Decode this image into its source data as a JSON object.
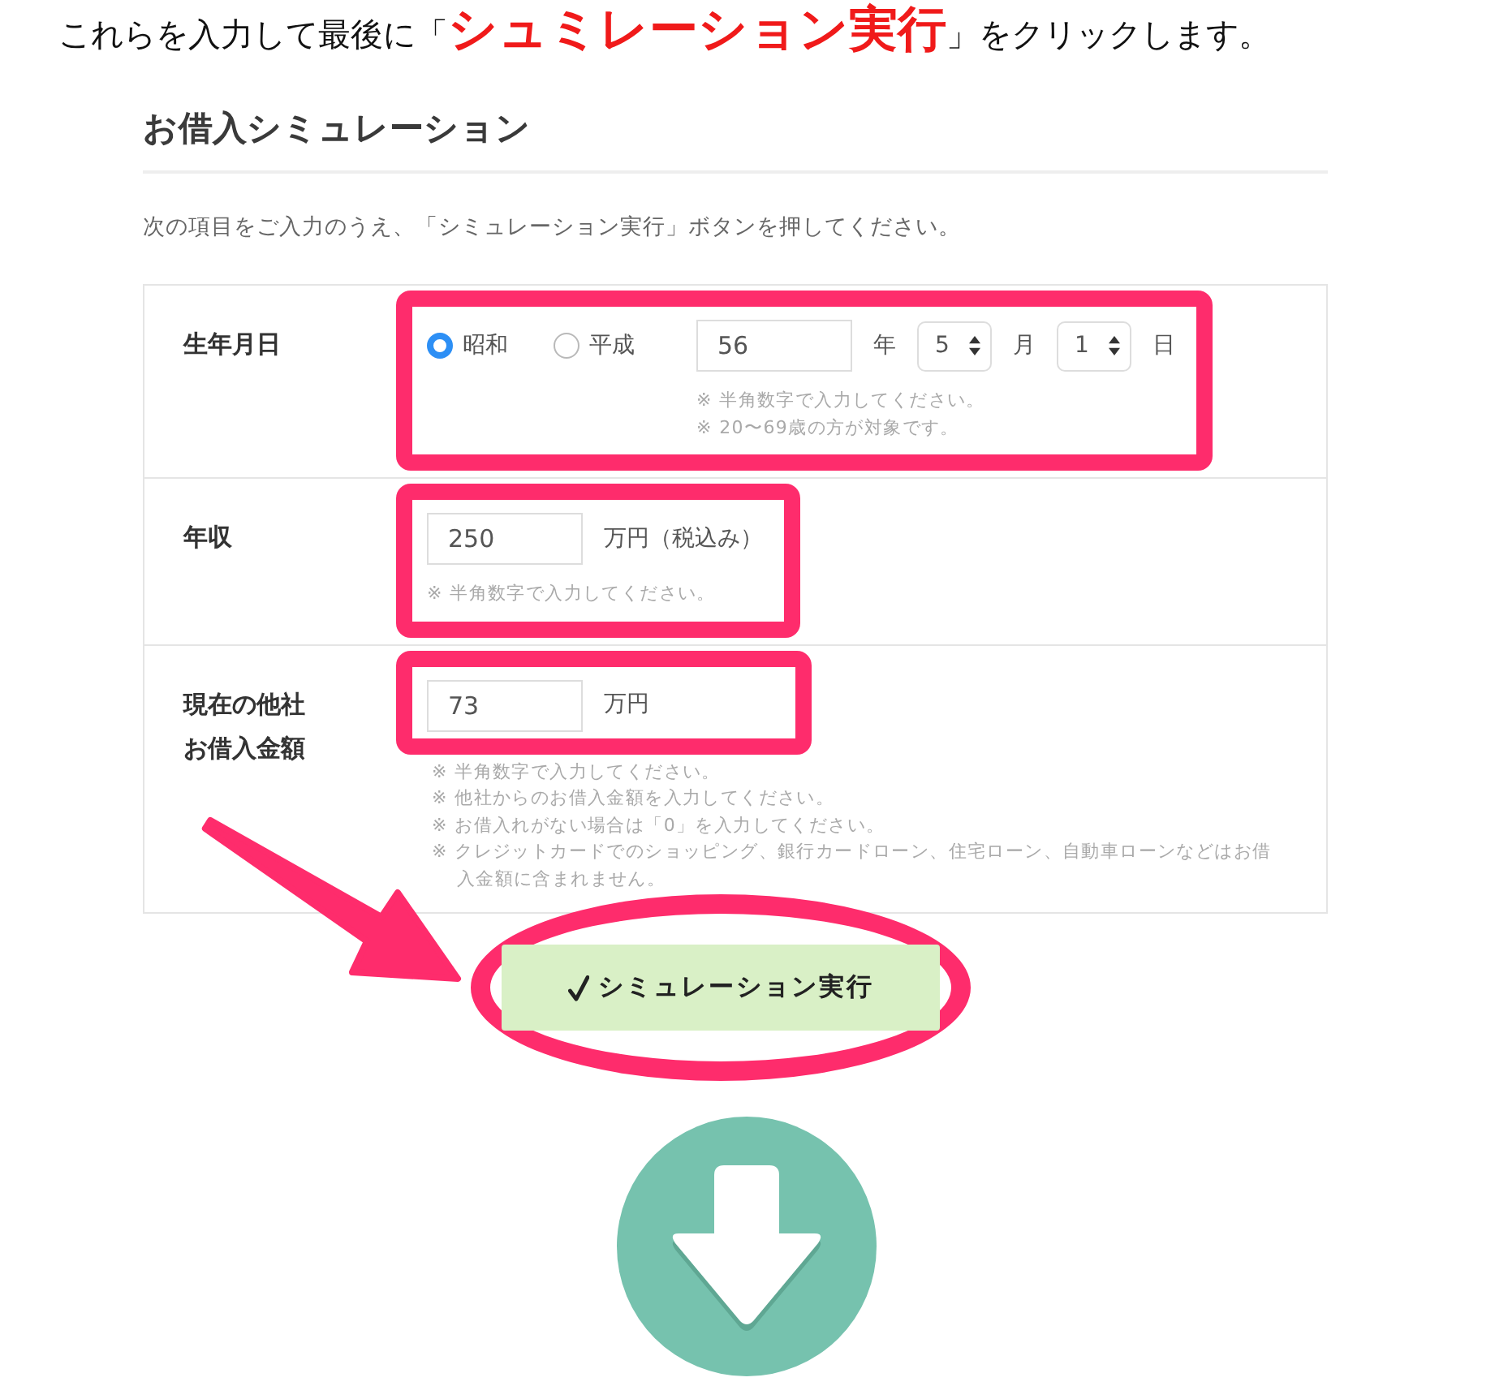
{
  "instruction": "これらを入力して最後に「**シュミレーション実行**」をクリックします。",
  "form": {
    "title": "お借入シミュレーション",
    "description": "次の項目をご入力のうえ、「シミュレーション実行」ボタンを押してください。",
    "rows": [
      {
        "label": "生年月日",
        "highlighted": true,
        "notes_highlighted": true,
        "options": [
          {
            "label": "昭和",
            "selected": true
          },
          {
            "label": "平成",
            "selected": false
          }
        ],
        "fields": [
          {
            "kind": "input",
            "value": "56"
          },
          {
            "kind": "unit",
            "text": "年"
          },
          {
            "kind": "select",
            "value": "5"
          },
          {
            "kind": "unit",
            "text": "月"
          },
          {
            "kind": "select",
            "value": "1"
          },
          {
            "kind": "unit",
            "text": "日"
          }
        ],
        "notes": [
          "※ 半角数字で入力してください。",
          "※ 20〜69歳の方が対象です。"
        ]
      },
      {
        "label": "年収",
        "highlighted": true,
        "notes_highlighted": true,
        "fields": [
          {
            "kind": "input",
            "value": "250"
          },
          {
            "kind": "unit",
            "text": "万円（税込み）"
          }
        ],
        "notes": [
          "※ 半角数字で入力してください。"
        ]
      },
      {
        "label": "現在の他社お借入金額",
        "highlighted": true,
        "notes_highlighted": false,
        "fields": [
          {
            "kind": "input",
            "value": "73"
          },
          {
            "kind": "unit",
            "text": "万円"
          }
        ],
        "notes": [
          "※ 半角数字で入力してください。",
          "※ 他社からのお借入金額を入力してください。",
          "※ お借入れがない場合は「0」を入力してください。",
          "※ クレジットカードでのショッピング、銀行カードローン、住宅ローン、自動車ローンなどはお借入金額に含まれません。"
        ]
      }
    ],
    "submit": {
      "label": "シミュレーション実行",
      "highlighted": true
    }
  }
}
